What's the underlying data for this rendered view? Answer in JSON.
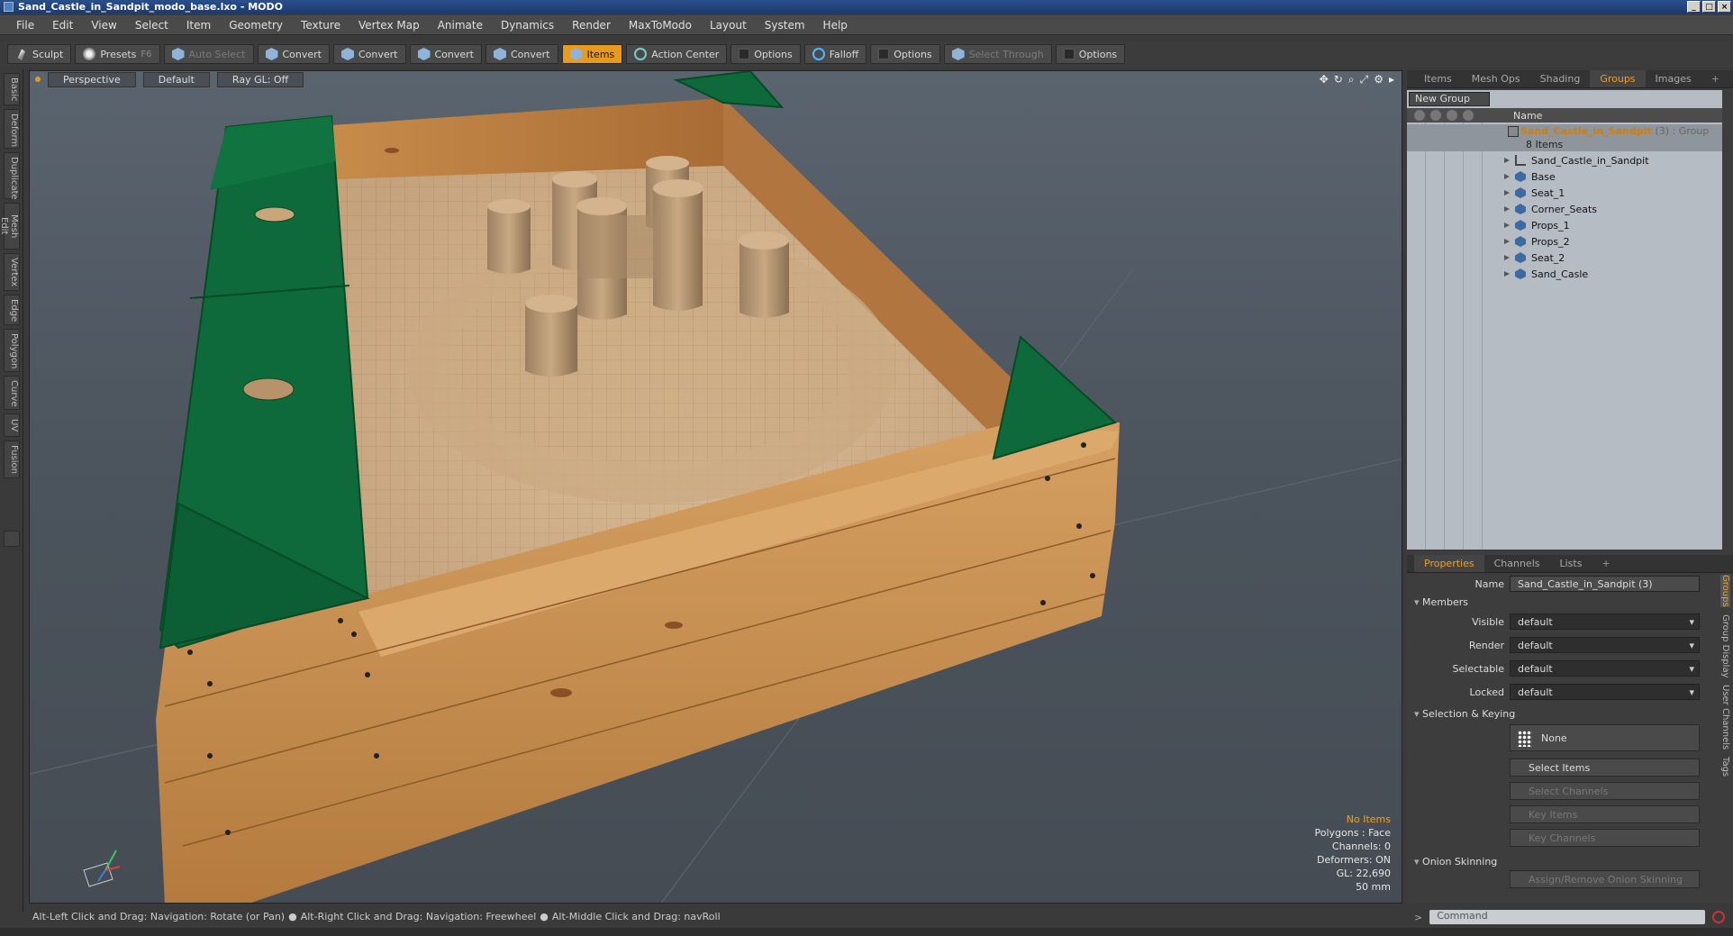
{
  "window": {
    "title": "Sand_Castle_in_Sandpit_modo_base.lxo - MODO"
  },
  "menu": [
    "File",
    "Edit",
    "View",
    "Select",
    "Item",
    "Geometry",
    "Texture",
    "Vertex Map",
    "Animate",
    "Dynamics",
    "Render",
    "MaxToModo",
    "Layout",
    "System",
    "Help"
  ],
  "toolbar": {
    "sculpt": "Sculpt",
    "presets": "Presets",
    "presets_key": "F6",
    "auto_select": "Auto Select",
    "convert1": "Convert",
    "convert2": "Convert",
    "convert3": "Convert",
    "convert4": "Convert",
    "items": "Items",
    "action_center": "Action Center",
    "options1": "Options",
    "falloff": "Falloff",
    "options2": "Options",
    "select_through": "Select Through",
    "options3": "Options"
  },
  "left_tabs": [
    "Basic",
    "Deform",
    "Duplicate",
    "Mesh Edit",
    "Vertex",
    "Edge",
    "Polygon",
    "Curve",
    "UV",
    "Fusion"
  ],
  "viewport": {
    "view": "Perspective",
    "shading": "Default",
    "raygl": "Ray GL: Off",
    "info": {
      "items": "No Items",
      "polygons": "Polygons : Face",
      "channels": "Channels: 0",
      "deformers": "Deformers: ON",
      "gl": "GL: 22,690",
      "lens": "50 mm"
    }
  },
  "groups_panel": {
    "tabs": [
      "Items",
      "Mesh Ops",
      "Shading",
      "Groups",
      "Images"
    ],
    "active_tab": "Groups",
    "new_group": "New Group",
    "col_name": "Name",
    "group": {
      "name": "Sand_Castle_in_Sandpit",
      "tag": "(3) : Group",
      "count": "8 Items"
    },
    "members": [
      "Sand_Castle_in_Sandpit",
      "Base",
      "Seat_1",
      "Corner_Seats",
      "Props_1",
      "Props_2",
      "Seat_2",
      "Sand_Casle"
    ]
  },
  "properties": {
    "tabs": [
      "Properties",
      "Channels",
      "Lists"
    ],
    "active_tab": "Properties",
    "name_label": "Name",
    "name_value": "Sand_Castle_in_Sandpit (3)",
    "members_section": "Members",
    "visible_label": "Visible",
    "visible_value": "default",
    "render_label": "Render",
    "render_value": "default",
    "selectable_label": "Selectable",
    "selectable_value": "default",
    "locked_label": "Locked",
    "locked_value": "default",
    "selection_section": "Selection & Keying",
    "none_btn": "None",
    "select_items": "Select Items",
    "select_channels": "Select Channels",
    "key_items": "Key Items",
    "key_channels": "Key Channels",
    "onion_section": "Onion Skinning",
    "assign_onion": "Assign/Remove Onion Skinning",
    "side_tabs": [
      "Groups",
      "Group Display",
      "User Channels",
      "Tags"
    ]
  },
  "status": {
    "hint1": "Alt-Left Click and Drag: Navigation: Rotate (or Pan)",
    "hint2": "Alt-Right Click and Drag: Navigation: Freewheel",
    "hint3": "Alt-Middle Click and Drag: navRoll",
    "command_placeholder": "Command"
  },
  "colors": {
    "accent": "#e89a1e",
    "wood": "#c8924e",
    "green": "#0e6a3a",
    "sand": "#cfae88"
  }
}
